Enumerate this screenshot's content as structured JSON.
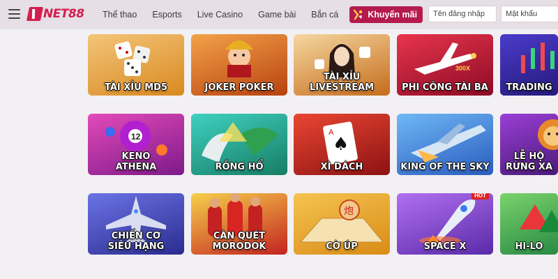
{
  "header": {
    "logo_text": "NET88",
    "nav": [
      "Thể thao",
      "Esports",
      "Live Casino",
      "Game bài",
      "Bắn cá"
    ],
    "promo_label": "Khuyến mãi",
    "username_placeholder": "Tên đăng nhập",
    "password_placeholder": "Mật khẩu"
  },
  "games": [
    {
      "label": "TÀI XỈU MD5",
      "bg": [
        "#f3c57a",
        "#d9891f"
      ],
      "art": "dice-icon"
    },
    {
      "label": "JOKER POKER",
      "bg": [
        "#f3a24a",
        "#b8420f"
      ],
      "art": "joker-icon"
    },
    {
      "label": "TÀI XỈU\nLIVESTREAM",
      "bg": [
        "#f5d7a0",
        "#c56c1c"
      ],
      "art": "dealer-icon"
    },
    {
      "label": "PHI CÔNG TÀI BA",
      "bg": [
        "#e8354d",
        "#8c0b25"
      ],
      "art": "plane-icon"
    },
    {
      "label": "TRADING",
      "bg": [
        "#4b3bcc",
        "#251a7a"
      ],
      "art": "candles-icon"
    },
    {
      "label": "KENO\nATHENA",
      "bg": [
        "#e34ab9",
        "#7d1a8a"
      ],
      "art": "ball-icon"
    },
    {
      "label": "RỒNG HỔ",
      "bg": [
        "#3fd0c0",
        "#177d64"
      ],
      "art": "dragon-tiger-icon"
    },
    {
      "label": "XÌ DÁCH",
      "bg": [
        "#ea4632",
        "#8c1213"
      ],
      "art": "card-icon"
    },
    {
      "label": "KING OF THE SKY",
      "bg": [
        "#6fb8f5",
        "#2a5cbf"
      ],
      "art": "jet-icon"
    },
    {
      "label": "LỄ HỘ\nRỪNG XA",
      "bg": [
        "#9b3fd6",
        "#4a1a7a"
      ],
      "art": "lion-icon"
    },
    {
      "label": "CHIẾN CƠ\nSIÊU HẠNG",
      "bg": [
        "#6b73e5",
        "#2a2c8f"
      ],
      "art": "fighter-icon"
    },
    {
      "label": "CÀN QUÉT\nMORODOK",
      "bg": [
        "#f6d04b",
        "#c42220"
      ],
      "art": "soccer-icon"
    },
    {
      "label": "CỜ ÚP",
      "bg": [
        "#f5c350",
        "#d98c16"
      ],
      "art": "chess-icon"
    },
    {
      "label": "SPACE X",
      "bg": [
        "#b070f0",
        "#5a2aa8"
      ],
      "art": "rocket-icon",
      "badge": "HOT"
    },
    {
      "label": "HI-LO",
      "bg": [
        "#7ad36b",
        "#2a8a45"
      ],
      "art": "hilo-icon"
    }
  ]
}
